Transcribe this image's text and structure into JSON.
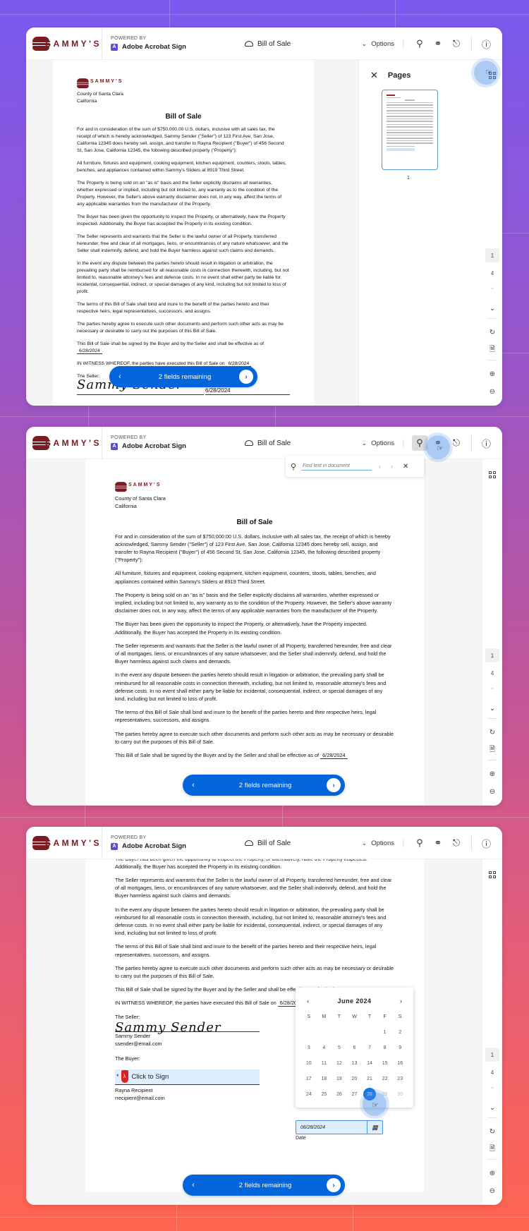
{
  "header": {
    "brand": "SAMMY'S",
    "powered_by": "POWERED BY",
    "product": "Adobe Acrobat Sign",
    "doc_title": "Bill of Sale",
    "options_label": "Options",
    "icons": [
      "search-icon",
      "headphones-icon",
      "globe-icon",
      "help-icon"
    ]
  },
  "document": {
    "brand": "SAMMY'S",
    "county": "County of Santa Clara",
    "state": "California",
    "title": "Bill of Sale",
    "paragraphs": [
      "For and in consideration of the sum of $750,000.00 U.S. dollars, inclusive with all sales tax, the receipt of which is hereby acknowledged, Sammy Sender (\"Seller\") of 123 First Ave, San Jose, California 12345 does hereby sell, assign, and transfer to Rayna Recipient (\"Buyer\") of 456 Second St, San Jose, California 12345, the following described property (\"Property\"):",
      "All furniture, fixtures and equipment, cooking equipment, kitchen equipment, counters, stools, tables, benches, and appliances contained within Sammy's Sliders at 8919 Third Street.",
      "The Property is being sold on an \"as is\" basis and the Seller explicitly disclaims all warranties, whether expressed or implied, including but not limited to, any warranty as to the condition of the Property. However, the Seller's above warranty disclaimer does not, in any way, affect the terms of any applicable warranties from the manufacturer of the Property.",
      "The Buyer has been given the opportunity to inspect the Property, or alternatively, have the Property inspected. Additionally, the Buyer has accepted the Property in its existing condition.",
      "The Seller represents and warrants that the Seller is the lawful owner of all Property, transferred hereunder, free and clear of all mortgages, liens, or encumbrances of any nature whatsoever, and the Seller shall indemnify, defend, and hold the Buyer harmless against such claims and demands.",
      "In the event any dispute between the parties hereto should result in litigation or arbitration, the prevailing party shall be reimbursed for all reasonable costs in connection therewith, including, but not limited to, reasonable attorney's fees and defense costs. In no event shall either party be liable for incidental, consequential, indirect, or special damages of any kind, including but not limited to loss of profit.",
      "The terms of this Bill of Sale shall bind and inure to the benefit of the parties hereto and their respective heirs, legal representatives, successors, and assigns.",
      "The parties hereby agree to execute such other documents and perform such other acts as may be necessary or desirable to carry out the purposes of this Bill of Sale."
    ],
    "effective_text": "This Bill of Sale shall be signed by the Buyer and by the Seller and shall be effective as of",
    "effective_date": "6/28/2024",
    "witness_text": "IN WITNESS WHEREOF, the parties have executed this Bill of Sale on",
    "witness_date": "6/28/2024",
    "seller_label": "The Seller:",
    "seller_signature": "Sammy Sender",
    "seller_name": "Sammy Sender",
    "seller_email": "ssender@email.com",
    "seller_date": "6/28/2024",
    "date_label": "Date",
    "buyer_label": "The Buyer:",
    "click_to_sign": "Click to Sign",
    "buyer_name": "Rayna Recipient",
    "buyer_email": "rrecipient@email.com"
  },
  "fields_nav": {
    "label": "2 fields remaining"
  },
  "pages_panel": {
    "title": "Pages",
    "thumb_label": "1"
  },
  "page_nav": {
    "current": "1",
    "total": "4"
  },
  "search": {
    "placeholder": "Find text in document"
  },
  "calendar": {
    "month": "June 2024",
    "weekdays": [
      "S",
      "M",
      "T",
      "W",
      "T",
      "F",
      "S"
    ],
    "days": [
      "",
      "",
      "",
      "",
      "",
      "1",
      "2",
      "3",
      "4",
      "5",
      "6",
      "7",
      "8",
      "9",
      "10",
      "11",
      "12",
      "13",
      "14",
      "15",
      "16",
      "17",
      "18",
      "19",
      "20",
      "21",
      "22",
      "23",
      "24",
      "25",
      "26",
      "27",
      "28",
      "29",
      "30"
    ],
    "selected": "28",
    "date_value": "06/28/2024"
  }
}
